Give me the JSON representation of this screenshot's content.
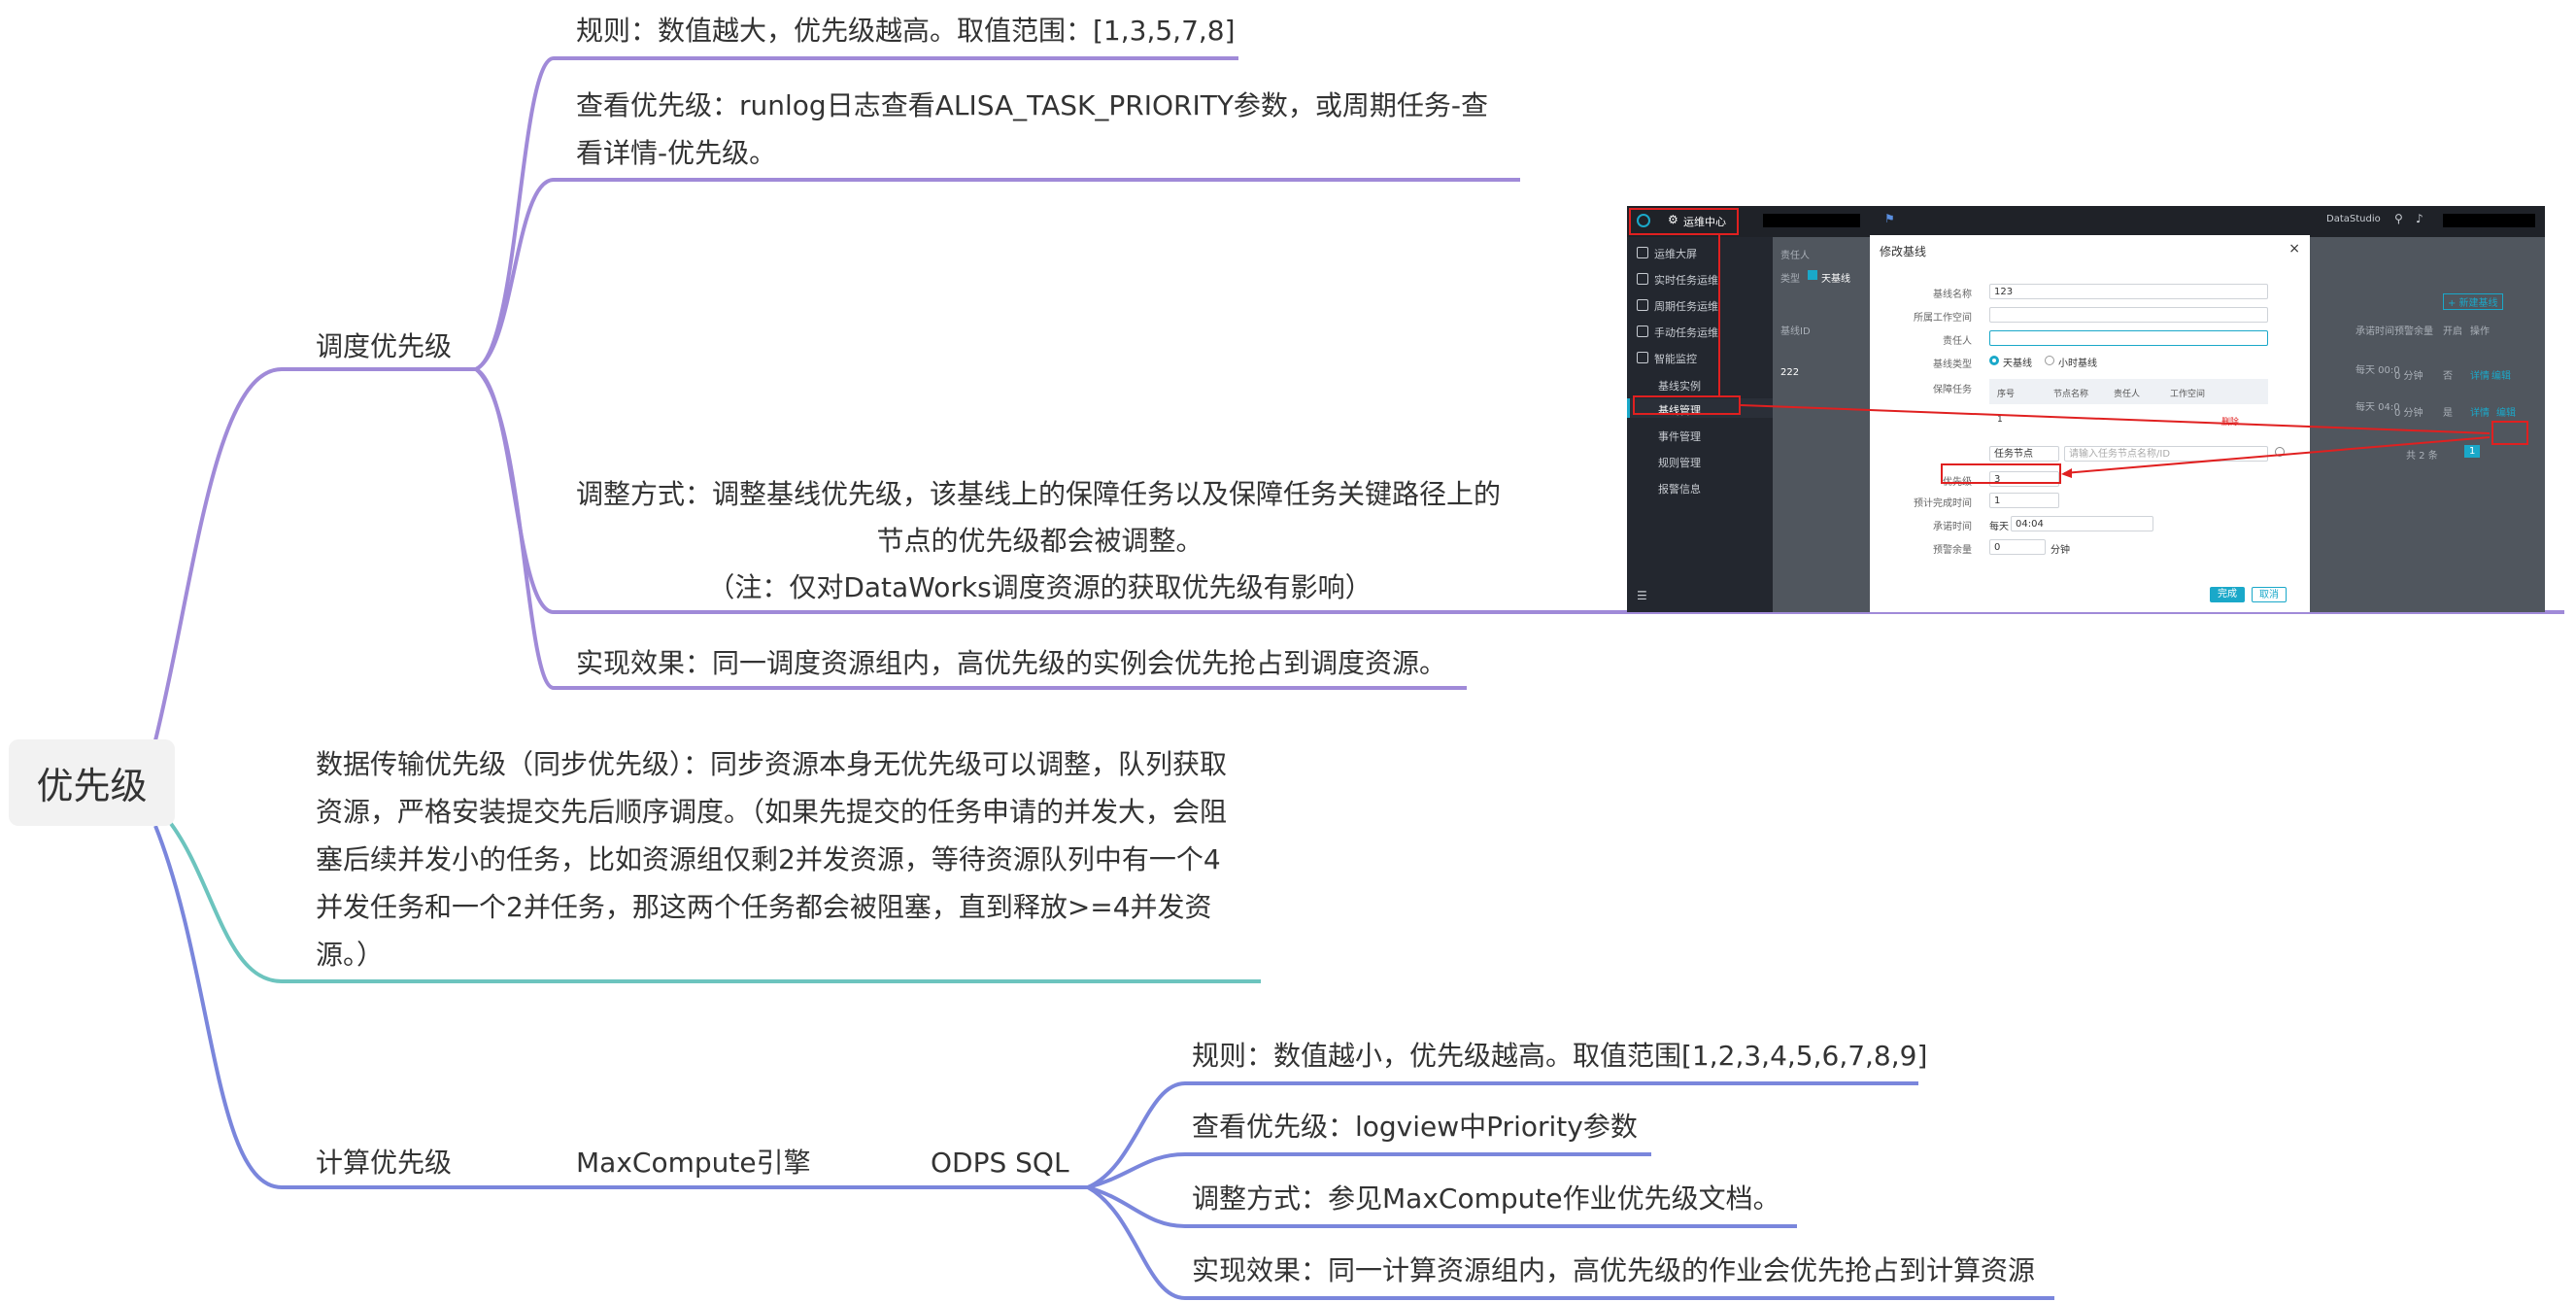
{
  "root": {
    "label": "优先级"
  },
  "colors": {
    "purple": "#a08ad8",
    "teal": "#6cc4be",
    "blue": "#7a86dc",
    "red": "#e02020",
    "accent": "#1aa8c9"
  },
  "scheduling": {
    "label": "调度优先级",
    "rule": "规则：数值越大，优先级越高。取值范围：[1,3,5,7,8]",
    "view_line1": "查看优先级：runlog日志查看ALISA_TASK_PRIORITY参数，或周期任务-查",
    "view_line2": "看详情-优先级。",
    "adjust_line1": "调整方式：调整基线优先级，该基线上的保障任务以及保障任务关键路径上的",
    "adjust_line2": "节点的优先级都会被调整。",
    "adjust_line3": "（注：仅对DataWorks调度资源的获取优先级有影响）",
    "effect": "实现效果：同一调度资源组内，高优先级的实例会优先抢占到调度资源。"
  },
  "transfer": {
    "line1": "数据传输优先级（同步优先级）：同步资源本身无优先级可以调整，队列获取",
    "line2": "资源，严格安装提交先后顺序调度。（如果先提交的任务申请的并发大，会阻",
    "line3": "塞后续并发小的任务，比如资源组仅剩2并发资源，等待资源队列中有一个4",
    "line4": "并发任务和一个2并任务，那这两个任务都会被阻塞，直到释放>=4并发资",
    "line5": "源。）"
  },
  "compute": {
    "label": "计算优先级",
    "engine": "MaxCompute引擎",
    "sql": "ODPS SQL",
    "rule": "规则：数值越小，优先级越高。取值范围[1,2,3,4,5,6,7,8,9]",
    "view": "查看优先级：logview中Priority参数",
    "adjust": "调整方式：参见MaxCompute作业优先级文档。",
    "effect": "实现效果：同一计算资源组内，高优先级的作业会优先抢占到计算资源"
  },
  "screenshot": {
    "header_menu": "运维中心",
    "brand": "DataStudio",
    "sidebar": [
      "运维大屏",
      "实时任务运维",
      "周期任务运维",
      "手动任务运维",
      "智能监控",
      "基线实例",
      "基线管理",
      "事件管理",
      "规则管理",
      "报警信息"
    ],
    "dialog_title": "修改基线",
    "close": "×",
    "fields": {
      "name_label": "基线名称",
      "name_value": "123",
      "workspace_label": "所属工作空间",
      "owner_label": "责任人",
      "type_label": "基线类型",
      "type_day": "天基线",
      "type_hour": "小时基线",
      "tasks_label": "保障任务",
      "cols": [
        "序号",
        "节点名称",
        "责任人",
        "工作空间"
      ],
      "row_index": "1",
      "row_delete": "删除",
      "node_select": "任务节点",
      "node_placeholder": "请输入任务节点名称/ID",
      "priority_label": "优先级",
      "priority_value": "3",
      "finish_label": "预计完成时间",
      "finish_value": "1",
      "promise_label": "承诺时间",
      "promise_prefix": "每天",
      "promise_value": "04:04",
      "alert_label": "预警余量",
      "alert_value": "0",
      "alert_unit": "分钟"
    },
    "ok": "完成",
    "cancel": "取消",
    "bg": {
      "owner": "责任人",
      "type": "类型",
      "day": "天基线",
      "new": "+ 新建基线",
      "baseline_id": "基线ID",
      "cols_right": [
        "承诺时间",
        "预警余量",
        "开启",
        "操作"
      ],
      "rows": [
        {
          "id": "222",
          "time": "每天 00:0",
          "margin": "0 分钟",
          "on": "否",
          "ops": [
            "详情",
            "编辑"
          ]
        },
        {
          "id": "",
          "time": "每天 04:0",
          "margin": "0 分钟",
          "on": "是",
          "ops": [
            "详情",
            "编辑"
          ]
        }
      ],
      "total": "共 2 条",
      "page": "1"
    }
  }
}
